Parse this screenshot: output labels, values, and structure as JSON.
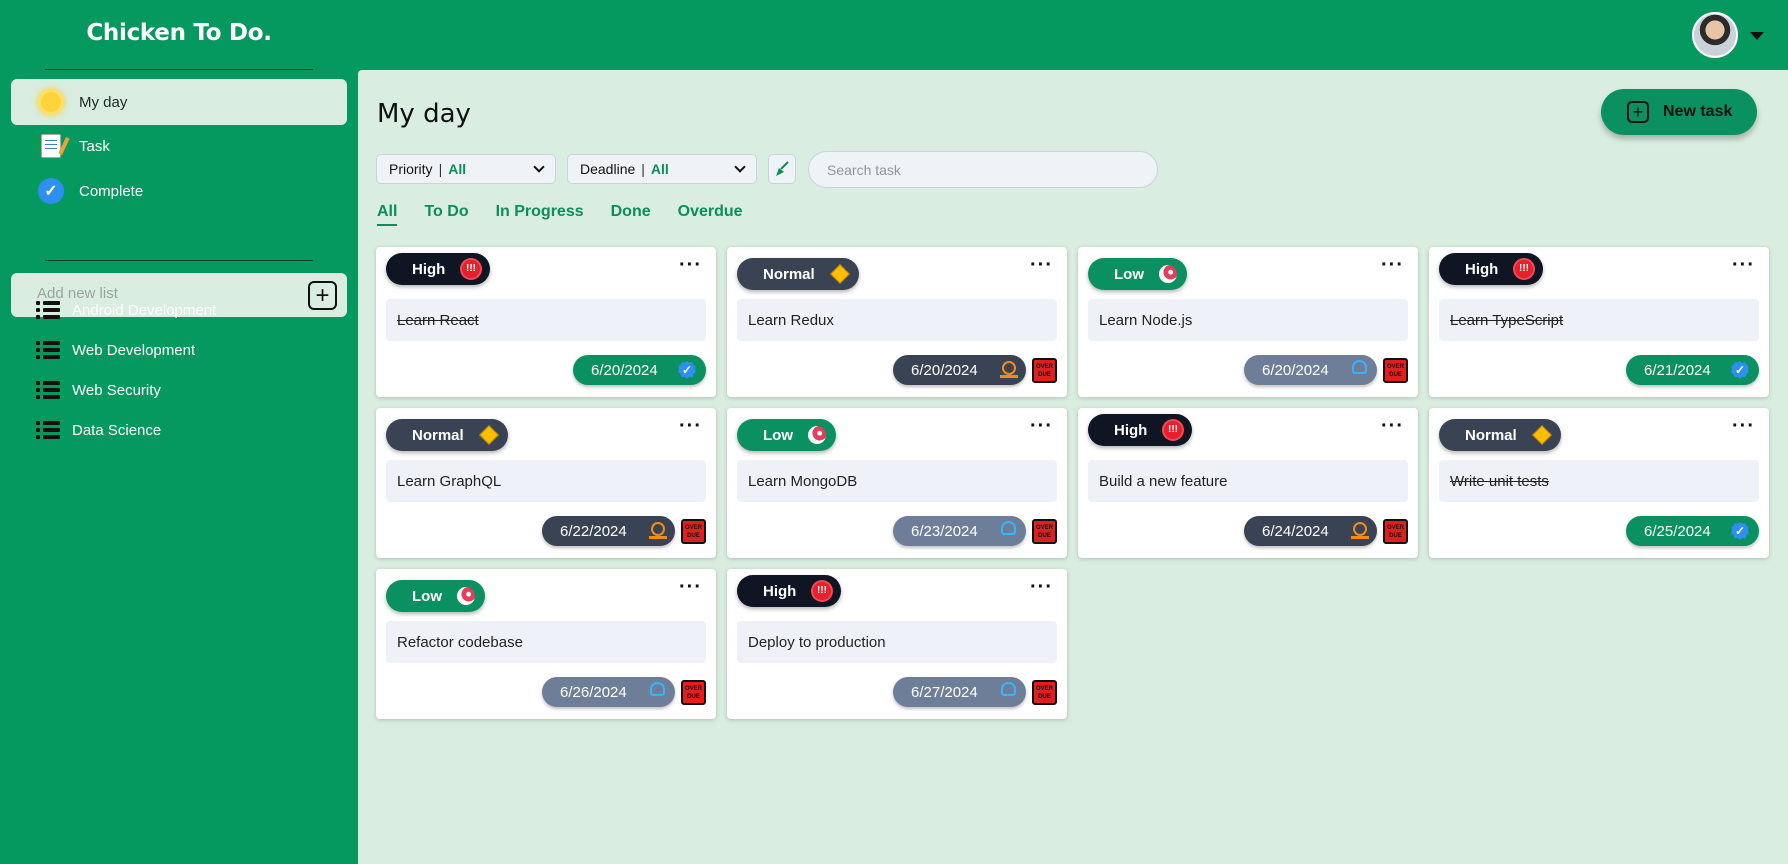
{
  "app": {
    "title": "Chicken To Do."
  },
  "sidebar": {
    "nav": [
      {
        "label": "My day",
        "icon": "sun-icon"
      },
      {
        "label": "Task",
        "icon": "memo-icon"
      },
      {
        "label": "Complete",
        "icon": "check-circle-icon"
      }
    ],
    "add_list_placeholder": "Add new list",
    "lists": [
      {
        "label": "Android Development"
      },
      {
        "label": "Web Development"
      },
      {
        "label": "Web Security"
      },
      {
        "label": "Data Science"
      }
    ]
  },
  "main": {
    "title": "My day",
    "new_task_label": "New task",
    "filters": {
      "priority": {
        "label": "Priority",
        "value": "All"
      },
      "deadline": {
        "label": "Deadline",
        "value": "All"
      }
    },
    "search_placeholder": "Search task",
    "tabs": [
      "All",
      "To Do",
      "In Progress",
      "Done",
      "Overdue"
    ],
    "active_tab": "All"
  },
  "tasks": [
    {
      "priority": "High",
      "title": "Learn React",
      "date": "6/20/2024",
      "status": "done",
      "overdue": false
    },
    {
      "priority": "Normal",
      "title": "Learn Redux",
      "date": "6/20/2024",
      "status": "in-progress",
      "overdue": true
    },
    {
      "priority": "Low",
      "title": "Learn Node.js",
      "date": "6/20/2024",
      "status": "todo",
      "overdue": true
    },
    {
      "priority": "High",
      "title": "Learn TypeScript",
      "date": "6/21/2024",
      "status": "done",
      "overdue": false
    },
    {
      "priority": "Normal",
      "title": "Learn GraphQL",
      "date": "6/22/2024",
      "status": "in-progress",
      "overdue": true
    },
    {
      "priority": "Low",
      "title": "Learn MongoDB",
      "date": "6/23/2024",
      "status": "todo",
      "overdue": true
    },
    {
      "priority": "High",
      "title": "Build a new feature",
      "date": "6/24/2024",
      "status": "in-progress",
      "overdue": true
    },
    {
      "priority": "Normal",
      "title": "Write unit tests",
      "date": "6/25/2024",
      "status": "done",
      "overdue": false
    },
    {
      "priority": "Low",
      "title": "Refactor codebase",
      "date": "6/26/2024",
      "status": "todo",
      "overdue": true
    },
    {
      "priority": "High",
      "title": "Deploy to production",
      "date": "6/27/2024",
      "status": "todo",
      "overdue": true
    }
  ],
  "badges": {
    "overdue_text": "OVER DUE",
    "high_icon_text": "!!!"
  },
  "colors": {
    "brand": "#06995f",
    "content_bg": "#d9ede0",
    "accent": "#0b8f56"
  }
}
